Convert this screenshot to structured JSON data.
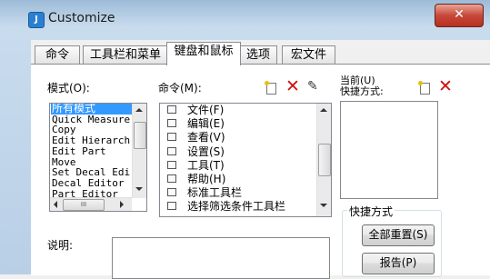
{
  "window": {
    "title": "Customize",
    "close_glyph": "✕"
  },
  "tabs": [
    {
      "label": "命令"
    },
    {
      "label": "工具栏和菜单"
    },
    {
      "label": "键盘和鼠标"
    },
    {
      "label": "选项"
    },
    {
      "label": "宏文件"
    }
  ],
  "modes": {
    "label": "模式(O):",
    "items": [
      "所有模式",
      "Quick Measure",
      "Copy",
      "Edit Hierarch",
      "Edit Part",
      "Move",
      "Set Decal Edi",
      "Decal Editor",
      "Part Editor"
    ],
    "selected_index": 0,
    "hscroll_glyph": "III"
  },
  "commands": {
    "label": "命令(M):",
    "items": [
      "文件(F)",
      "编辑(E)",
      "查看(V)",
      "设置(S)",
      "工具(T)",
      "帮助(H)",
      "标准工具栏",
      "选择筛选条件工具栏"
    ]
  },
  "current_shortcut": {
    "label": "当前(U)\n快捷方式:"
  },
  "shortcut_group": {
    "title": "快捷方式",
    "reset_all": "全部重置(S)",
    "report": "报告(P)"
  },
  "description": {
    "label": "说明:"
  }
}
